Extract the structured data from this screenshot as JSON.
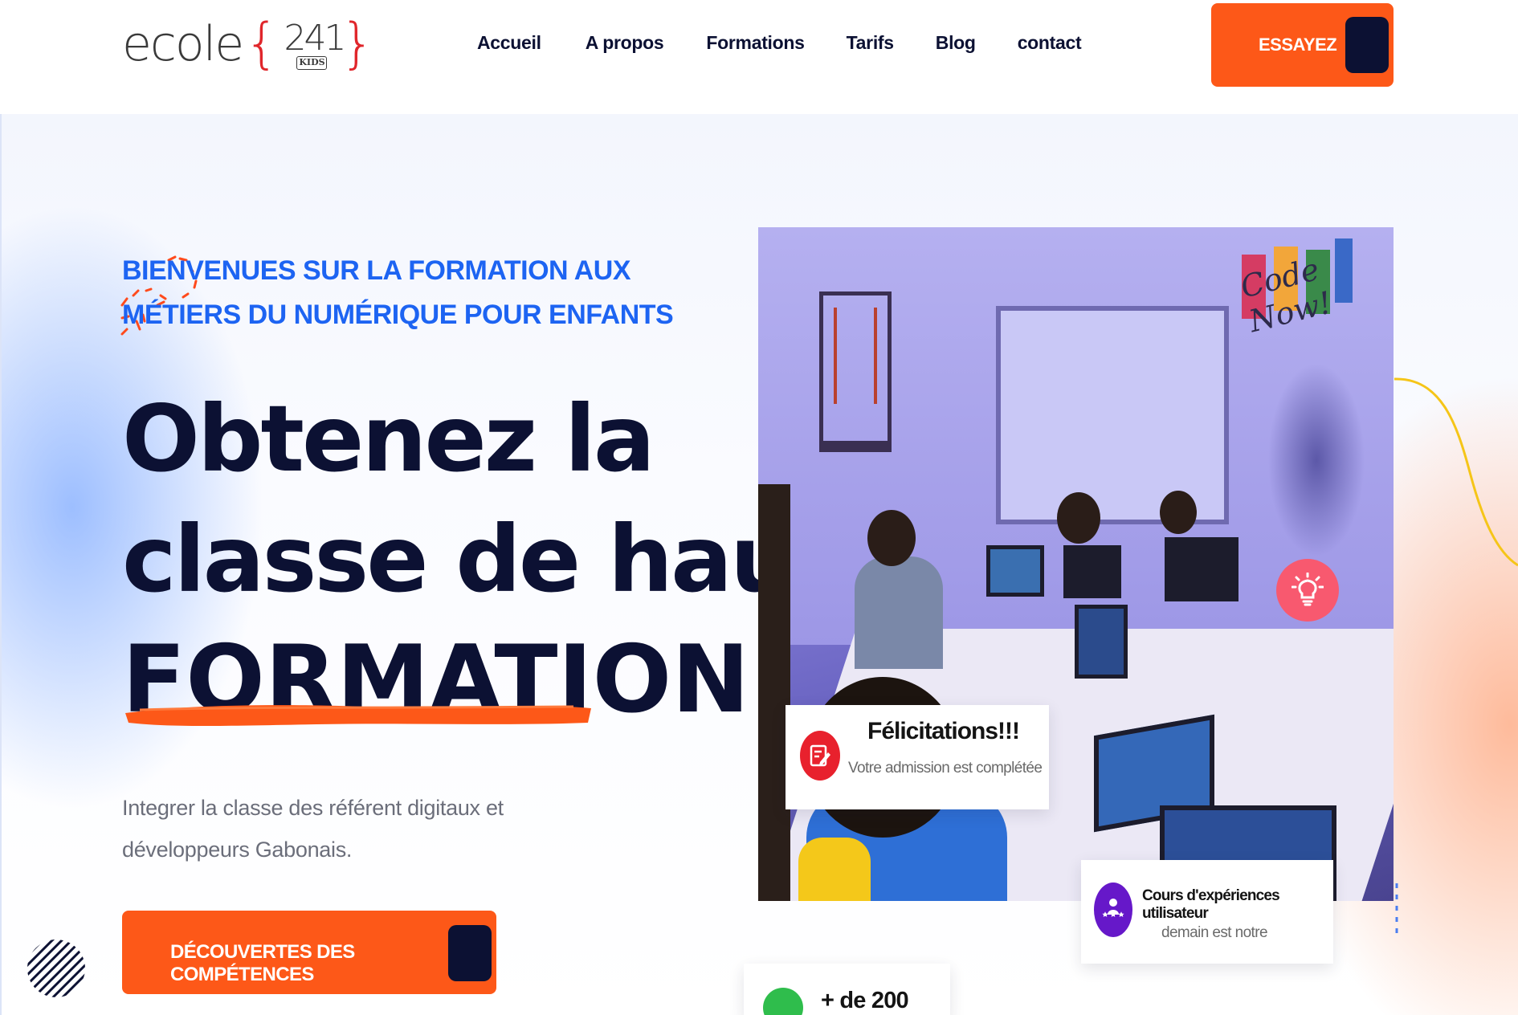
{
  "header": {
    "logo": {
      "word": "ecole",
      "brace_open": "{",
      "number": "241",
      "brace_close": "}",
      "kids": "KIDS"
    },
    "nav": [
      {
        "label": "Accueil"
      },
      {
        "label": "A propos"
      },
      {
        "label": "Formations"
      },
      {
        "label": "Tarifs"
      },
      {
        "label": "Blog"
      },
      {
        "label": "contact"
      }
    ],
    "cta_label": "ESSAYEZ"
  },
  "hero": {
    "subtitle": "BIENVENUES SUR LA FORMATION AUX MÉTIERS DU NUMÉRIQUE POUR ENFANTS",
    "headline_line1": "Obtenez la",
    "headline_line2": "classe de haute",
    "headline_line3": "FORMATION",
    "description": "Integrer la classe des référent digitaux et développeurs Gabonais.",
    "cta_label": "DÉCOUVERTES DES COMPÉTENCES"
  },
  "photo": {
    "wall_text": "Code Now!"
  },
  "cards": {
    "felicitations": {
      "title": "Félicitations!!!",
      "subtitle": "Votre admission est complétée"
    },
    "cours": {
      "title": "Cours d'expériences utilisateur",
      "subtitle": "demain est notre"
    },
    "stat": {
      "title": "+ de 200"
    }
  },
  "colors": {
    "accent": "#fd5818",
    "navy": "#0c1133",
    "subtitle_blue": "#1d64f2",
    "card_red": "#e8212d",
    "card_purple": "#6618c9",
    "card_green": "#2fbd4c",
    "bulb_pink": "#f8596f"
  },
  "icons": {
    "felicitations": "edit-document-icon",
    "cours": "user-group-icon",
    "stat": "graduation-cap-icon",
    "bulb": "lightbulb-icon"
  }
}
